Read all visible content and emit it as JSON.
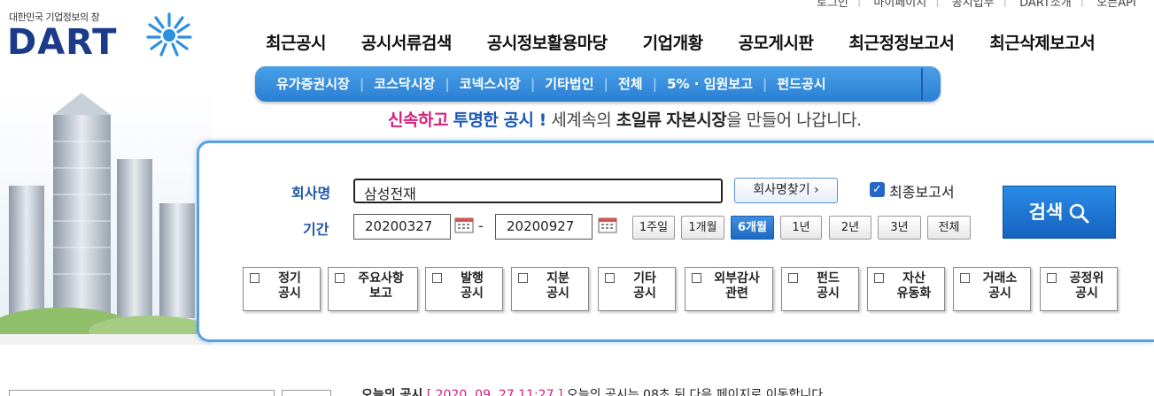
{
  "util_links": [
    "로그인",
    "마이페이지",
    "공시업무",
    "DART소개",
    "오픈API"
  ],
  "logo": {
    "tagline": "대한민국 기업정보의 창",
    "word": "DART"
  },
  "main_nav": [
    "최근공시",
    "공시서류검색",
    "공시정보활용마당",
    "기업개황",
    "공모게시판",
    "최근정정보고서",
    "최근삭제보고서"
  ],
  "sub_nav": [
    "유가증권시장",
    "코스닥시장",
    "코넥스시장",
    "기타법인",
    "전체",
    "5% · 임원보고",
    "펀드공시"
  ],
  "slogan": {
    "p1": "신속하고",
    "p2": "투명한 공시 !",
    "p3": "세계속의",
    "p4": "초일류",
    "p5": "자본시장",
    "p6": "을 만들어 나갑니다."
  },
  "search": {
    "company_label": "회사명",
    "company_value": "삼성전재",
    "find_button": "회사명찾기 ›",
    "final_report_label": "최종보고서",
    "period_label": "기간",
    "start_date": "20200327",
    "end_date": "20200927",
    "date_separator": "-",
    "period_buttons": [
      "1주일",
      "1개월",
      "6개월",
      "1년",
      "2년",
      "3년",
      "전체"
    ],
    "active_period": "6개월",
    "search_button": "검색"
  },
  "categories": [
    "정기\n공시",
    "주요사항\n보고",
    "발행\n공시",
    "지분\n공시",
    "기타\n공시",
    "외부감사\n관련",
    "펀드\n공시",
    "자산\n유동화",
    "거래소\n공시",
    "공정위\n공시"
  ],
  "bottom": {
    "today_label": "오늘의 공시",
    "today_time": "[ 2020. 09. 27 11:27 ]",
    "today_text": "오늘의 공시는 08초 뒤 다음 페이지로 이동합니다."
  },
  "colors": {
    "brand_blue": "#1b3a8a",
    "accent_blue": "#2a7fd3",
    "slogan_pink": "#d61d7a"
  }
}
